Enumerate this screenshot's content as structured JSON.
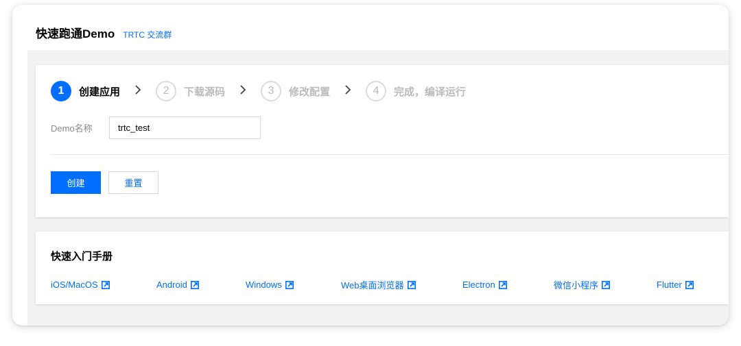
{
  "header": {
    "title": "快速跑通Demo",
    "link": "TRTC 交流群"
  },
  "steps": [
    {
      "num": "1",
      "label": "创建应用",
      "active": true
    },
    {
      "num": "2",
      "label": "下载源码",
      "active": false
    },
    {
      "num": "3",
      "label": "修改配置",
      "active": false
    },
    {
      "num": "4",
      "label": "完成，编译运行",
      "active": false
    }
  ],
  "form": {
    "demo_name_label": "Demo名称",
    "demo_name_value": "trtc_test"
  },
  "buttons": {
    "create": "创建",
    "reset": "重置"
  },
  "manual": {
    "title": "快速入门手册",
    "links": [
      "iOS/MacOS",
      "Android",
      "Windows",
      "Web桌面浏览器",
      "Electron",
      "微信小程序",
      "Flutter"
    ]
  },
  "colors": {
    "accent": "#006eff"
  },
  "icons": {
    "step_separator": "chevron-right-icon",
    "external_link": "external-link-icon"
  }
}
